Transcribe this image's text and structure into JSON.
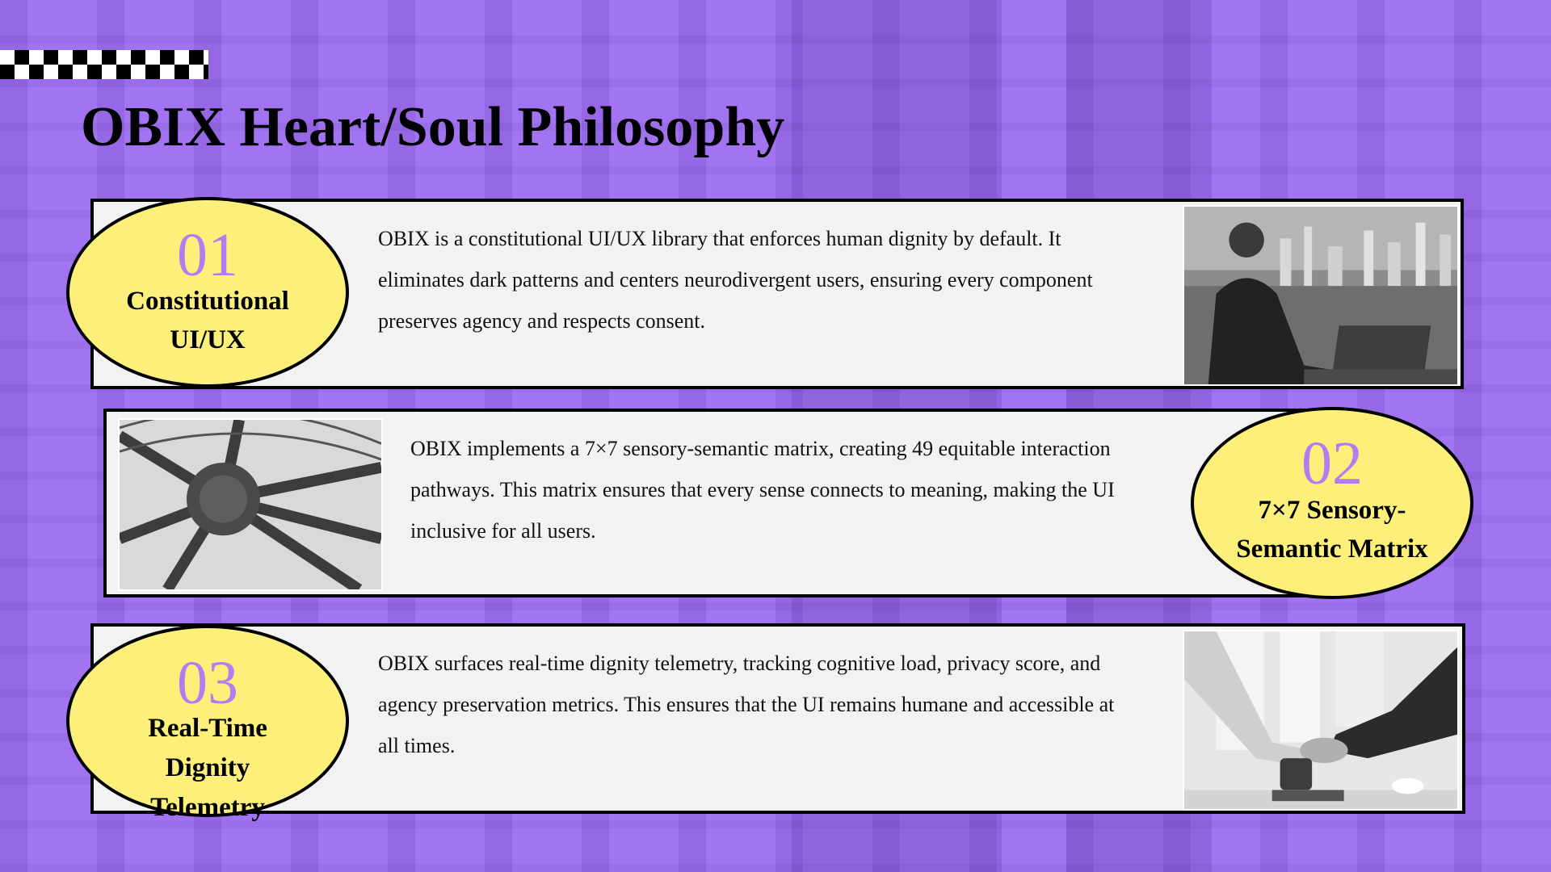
{
  "slide": {
    "title": "OBIX Heart/Soul Philosophy"
  },
  "colors": {
    "background": "#a070f2",
    "card": "#f2f2f2",
    "badge": "#fcf07a",
    "number": "#b57cf2"
  },
  "sections": [
    {
      "number": "01",
      "label_lines": [
        "Constitutional",
        "UI/UX"
      ],
      "text": "OBIX is a constitutional UI/UX library that enforces human dignity by default. It eliminates dark patterns and centers neurodivergent users, ensuring every component preserves agency and respects consent.",
      "image": "businessman-laptop-city-photo"
    },
    {
      "number": "02",
      "label_lines": [
        "7×7 Sensory-",
        "Semantic Matrix"
      ],
      "text": "OBIX implements a 7×7 sensory-semantic matrix, creating 49 equitable interaction pathways. This matrix ensures that every sense connects to meaning, making the UI inclusive for all users.",
      "image": "steel-wheel-structure-photo"
    },
    {
      "number": "03",
      "label_lines": [
        "Real-Time",
        "Dignity",
        "Telemetry"
      ],
      "text": "OBIX surfaces real-time dignity telemetry, tracking cognitive load, privacy score, and agency preservation metrics. This ensures that the UI remains humane and accessible at all times.",
      "image": "handshake-office-photo"
    }
  ]
}
